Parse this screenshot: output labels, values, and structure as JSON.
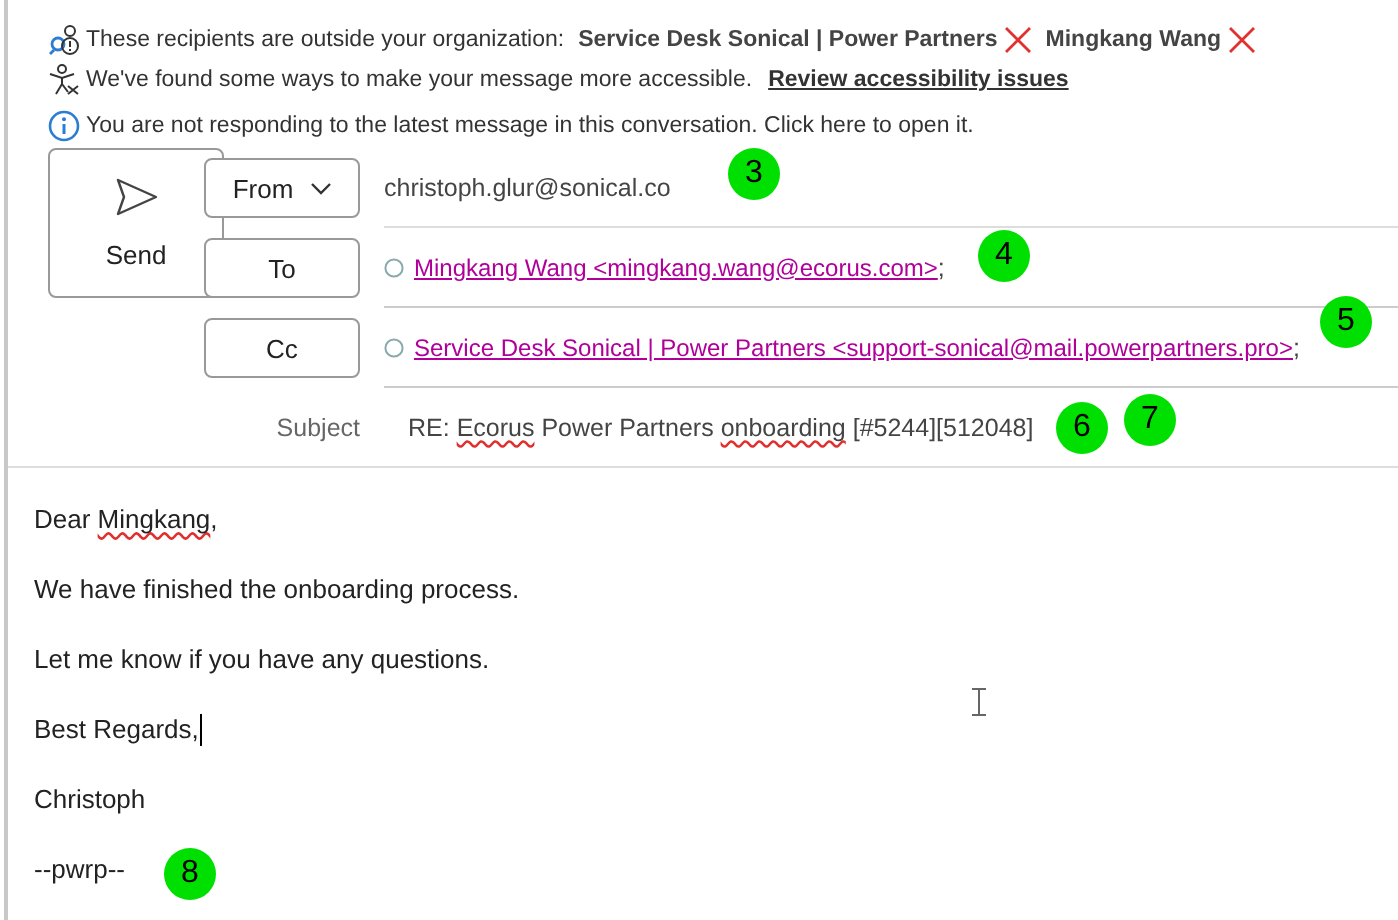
{
  "banners": [
    {
      "kind": "external",
      "text": "These recipients are outside your organization:",
      "recipients": [
        {
          "name": "Service Desk Sonical | Power Partners"
        },
        {
          "name": "Mingkang Wang"
        }
      ]
    },
    {
      "kind": "accessibility",
      "text": "We've found some ways to make your message more accessible.",
      "link": "Review accessibility issues"
    },
    {
      "kind": "info",
      "text": "You are not responding to the latest message in this conversation. Click here to open it."
    }
  ],
  "send_button": "Send",
  "fields": [
    {
      "kind": "from",
      "button": "From",
      "dropdown": true,
      "value": "christoph.glur@sonical.co"
    },
    {
      "kind": "recipients",
      "button": "To",
      "recipients": [
        {
          "text": "Mingkang Wang <mingkang.wang@ecorus.com>",
          "separator": ";"
        }
      ]
    },
    {
      "kind": "recipients",
      "button": "Cc",
      "recipients": [
        {
          "text": "Service Desk Sonical | Power Partners <support-sonical@mail.powerpartners.pro>",
          "separator": ";"
        }
      ]
    },
    {
      "kind": "subject",
      "label": "Subject",
      "parts": [
        {
          "text": "RE: ",
          "misspelled": false
        },
        {
          "text": "Ecorus",
          "misspelled": true
        },
        {
          "text": " Power Partners ",
          "misspelled": false
        },
        {
          "text": "onboarding",
          "misspelled": true
        },
        {
          "text": " [#5244][512048]",
          "misspelled": false
        }
      ]
    }
  ],
  "body": [
    {
      "parts": [
        {
          "text": "Dear ",
          "misspelled": false
        },
        {
          "text": "Mingkang",
          "misspelled": true
        },
        {
          "text": ",",
          "misspelled": false
        }
      ],
      "caret": false
    },
    {
      "parts": [
        {
          "text": "We have finished the onboarding process.",
          "misspelled": false
        }
      ],
      "caret": false
    },
    {
      "parts": [
        {
          "text": "Let me know if you have any questions.",
          "misspelled": false
        }
      ],
      "caret": false
    },
    {
      "parts": [
        {
          "text": "Best Regards,",
          "misspelled": false
        }
      ],
      "caret": true
    },
    {
      "parts": [
        {
          "text": "Christoph",
          "misspelled": false
        }
      ],
      "caret": false
    },
    {
      "parts": [
        {
          "text": "--pwrp--",
          "misspelled": false
        }
      ],
      "caret": false
    }
  ],
  "markers": [
    {
      "label": "3"
    },
    {
      "label": "4"
    },
    {
      "label": "5"
    },
    {
      "label": "6"
    },
    {
      "label": "7"
    },
    {
      "label": "8"
    }
  ]
}
